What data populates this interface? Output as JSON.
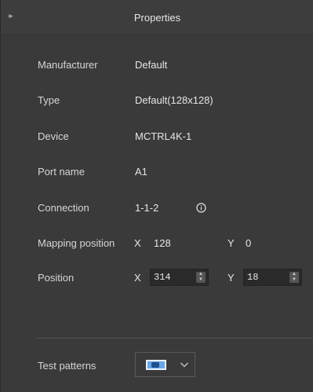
{
  "header": {
    "title": "Properties",
    "collapse_icon": "double-chevron-right-icon"
  },
  "properties": {
    "manufacturer": {
      "label": "Manufacturer",
      "value": "Default"
    },
    "type": {
      "label": "Type",
      "value": "Default(128x128)"
    },
    "device": {
      "label": "Device",
      "value": "MCTRL4K-1"
    },
    "port_name": {
      "label": "Port name",
      "value": "A1"
    },
    "connection": {
      "label": "Connection",
      "value": "1-1-2",
      "icon": "info-icon"
    },
    "mapping_position": {
      "label": "Mapping position",
      "x_label": "X",
      "x_value": "128",
      "y_label": "Y",
      "y_value": "0"
    },
    "position": {
      "label": "Position",
      "x_label": "X",
      "x_value": "314",
      "y_label": "Y",
      "y_value": "18"
    }
  },
  "test_patterns": {
    "label": "Test patterns",
    "icon": "test-pattern-icon",
    "dropdown_icon": "chevron-down-icon"
  },
  "colors": {
    "background": "#3a3a3a",
    "input_background": "#2a2a2a",
    "text": "#e6e6e6",
    "pattern_blue": "#6aa7e6"
  }
}
